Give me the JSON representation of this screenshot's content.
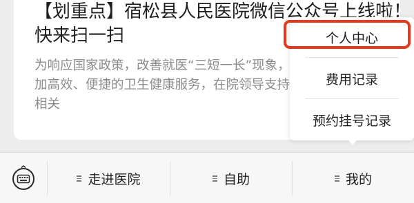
{
  "article": {
    "title": "【划重点】宿松县人民医院微信公众号上线啦！快来扫一扫",
    "summary": "为响应国家政策，改善就医“三短一长”现象，更加高效、便捷的卫生健康服务，在院领导支持和相关"
  },
  "bottom_menu": {
    "keyboard_icon": "keyboard-icon",
    "tabs": [
      {
        "label": "走进医院"
      },
      {
        "label": "自助"
      },
      {
        "label": "我的"
      }
    ]
  },
  "popup_menu": {
    "items": [
      {
        "label": "个人中心",
        "highlighted": true
      },
      {
        "label": "费用记录"
      },
      {
        "label": "预约挂号记录"
      }
    ]
  },
  "colors": {
    "highlight": "#e8371f",
    "background": "#ededed",
    "text_primary": "#1f1f1f",
    "text_secondary": "#8c8c8c"
  }
}
